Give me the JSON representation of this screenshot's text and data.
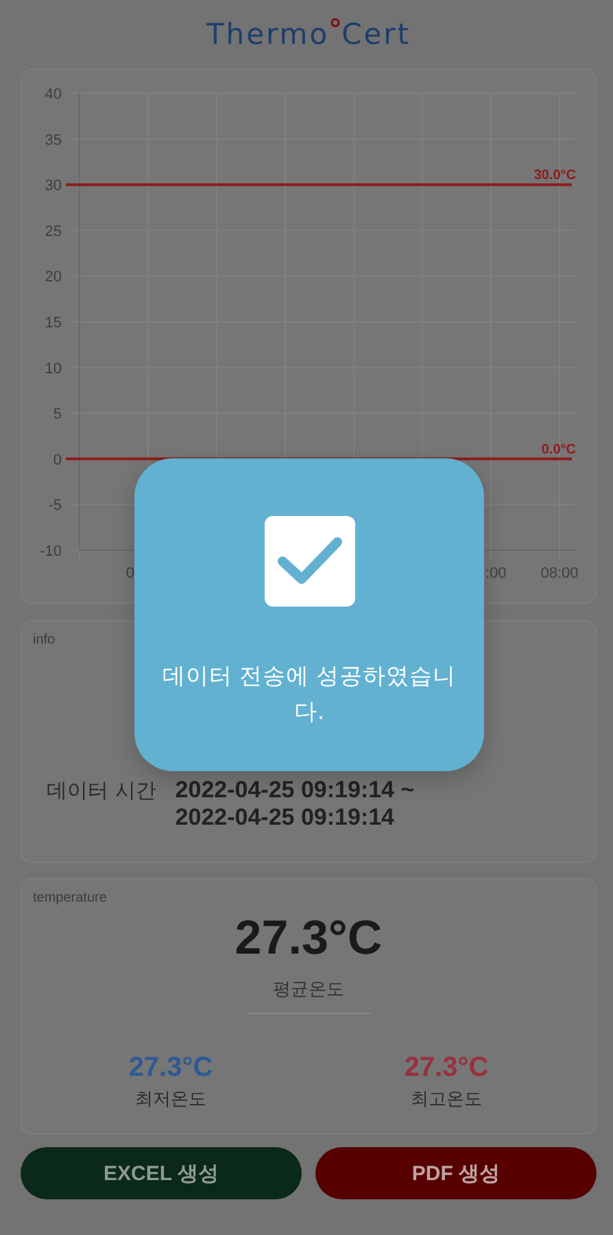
{
  "logo": {
    "left": "Thermo",
    "right": "Cert"
  },
  "chart": {
    "chart_data": {
      "type": "line",
      "ylim": [
        -10,
        40
      ],
      "grid": true,
      "yticks": [
        -10,
        -5,
        0,
        5,
        10,
        15,
        20,
        25,
        30,
        35,
        40
      ],
      "categories": [
        null,
        "0",
        null,
        null,
        null,
        null,
        ":00",
        "08:00"
      ],
      "series": [
        {
          "name": "30.0°C",
          "color": "#8e1c1c",
          "values": [
            30,
            30,
            30,
            30,
            30,
            30,
            30,
            30
          ]
        },
        {
          "name": "0.0°C",
          "color": "#8e1c1c",
          "values": [
            0,
            0,
            0,
            0,
            0,
            0,
            0,
            0
          ]
        }
      ]
    }
  },
  "info": {
    "title": "info",
    "rows": [
      {
        "label": "데이터 시간",
        "value_lines": [
          "2022-04-25 09:19:14 ~",
          "2022-04-25 09:19:14"
        ]
      }
    ]
  },
  "temperature": {
    "title": "temperature",
    "average": {
      "value": "27.3°C",
      "label": "평균온도"
    },
    "stats": [
      {
        "value": "27.3°C",
        "label": "최저온도",
        "color": "#2e5a94"
      },
      {
        "value": "27.3°C",
        "label": "최고온도",
        "color": "#98303f"
      }
    ]
  },
  "buttons": [
    {
      "label": "EXCEL 생성",
      "kind": "excel"
    },
    {
      "label": "PDF 생성",
      "kind": "pdf"
    }
  ],
  "dialog": {
    "checked": true,
    "message": "데이터 전송에 성공하였습니다."
  }
}
